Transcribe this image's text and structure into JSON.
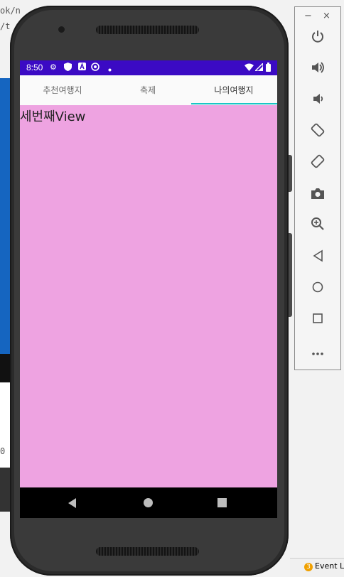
{
  "ide": {
    "line1": "ok/n",
    "line2": "/t",
    "line3": "0",
    "event_log_count": "3",
    "event_log_label": "Event Lo"
  },
  "status_bar": {
    "time": "8:50",
    "icons": [
      "gear-icon",
      "shield-icon",
      "a-icon",
      "at-icon",
      "dot-icon",
      "wifi-icon",
      "signal-icon",
      "battery-icon"
    ]
  },
  "tabs": [
    {
      "label": "추천여행지",
      "active": false
    },
    {
      "label": "축제",
      "active": false
    },
    {
      "label": "나의여행지",
      "active": true
    }
  ],
  "content": {
    "text": "세번째View",
    "background": "#eea3e1"
  },
  "colors": {
    "status_bar": "#3b0ac4",
    "tab_indicator": "#19c6c6"
  },
  "emulator_toolbar": {
    "minimize": "−",
    "close": "×",
    "buttons": [
      "power-icon",
      "volume-up-icon",
      "volume-down-icon",
      "rotate-left-icon",
      "rotate-right-icon",
      "camera-icon",
      "zoom-icon",
      "back-icon",
      "home-icon",
      "overview-icon",
      "more-icon"
    ]
  }
}
